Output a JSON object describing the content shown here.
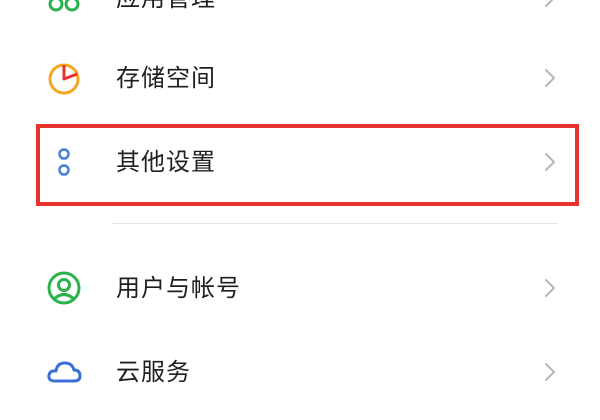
{
  "settings": {
    "items": [
      {
        "label": "应用管理",
        "icon": "apps-icon",
        "icon_color": "#2bb24c"
      },
      {
        "label": "存储空间",
        "icon": "storage-pie-icon",
        "icon_color": "#f5a623"
      },
      {
        "label": "其他设置",
        "icon": "more-dots-icon",
        "icon_color": "#4a7fd6"
      },
      {
        "label": "用户与帐号",
        "icon": "user-account-icon",
        "icon_color": "#2bb24c"
      },
      {
        "label": "云服务",
        "icon": "cloud-icon",
        "icon_color": "#3a6fd8"
      }
    ]
  },
  "colors": {
    "highlight": "#e8322e",
    "chevron": "#b8b8b8",
    "divider": "#e6e6e6"
  }
}
